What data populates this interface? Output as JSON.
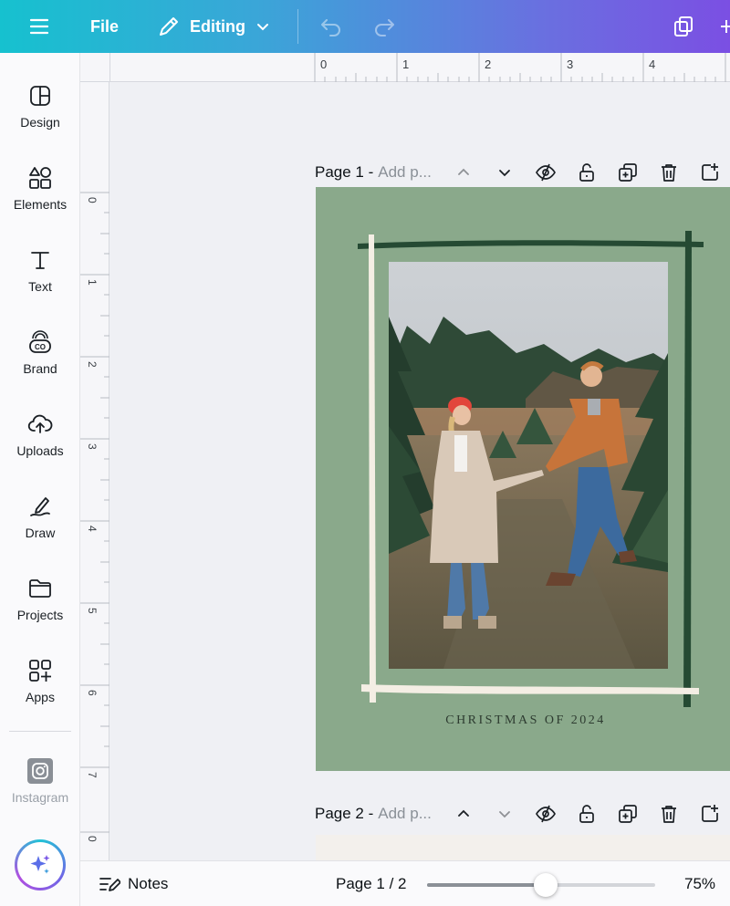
{
  "topbar": {
    "menu_icon": "hamburger-icon",
    "file_label": "File",
    "edit_mode_label": "Editing",
    "undo_icon": "undo-icon",
    "redo_icon": "redo-icon",
    "copy_icon": "duplicate-icon"
  },
  "sidebar": {
    "items": [
      {
        "label": "Design",
        "icon": "layout-icon"
      },
      {
        "label": "Elements",
        "icon": "shapes-icon"
      },
      {
        "label": "Text",
        "icon": "text-icon"
      },
      {
        "label": "Brand",
        "icon": "brand-icon"
      },
      {
        "label": "Uploads",
        "icon": "cloud-upload-icon"
      },
      {
        "label": "Draw",
        "icon": "pen-icon"
      },
      {
        "label": "Projects",
        "icon": "folder-icon"
      },
      {
        "label": "Apps",
        "icon": "apps-icon"
      }
    ],
    "instagram_label": "Instagram",
    "magic_icon": "sparkle-icon"
  },
  "rulers": {
    "top": [
      "0",
      "1",
      "2",
      "3",
      "4"
    ],
    "left": [
      "0",
      "1",
      "2",
      "3",
      "4",
      "5",
      "6",
      "7",
      "0"
    ]
  },
  "pages": [
    {
      "title": "Page 1 -",
      "subtitle": "Add p..."
    },
    {
      "title": "Page 2 -",
      "subtitle": "Add p..."
    }
  ],
  "design": {
    "caption": "CHRISTMAS OF 2024",
    "background_color": "#8aa98b"
  },
  "bottombar": {
    "notes_label": "Notes",
    "page_indicator": "Page 1 / 2",
    "zoom_label": "75%",
    "zoom_fraction": 0.52
  },
  "colors": {
    "brand_gradient_start": "#16c1cf",
    "brand_gradient_end": "#7b4fe3"
  }
}
